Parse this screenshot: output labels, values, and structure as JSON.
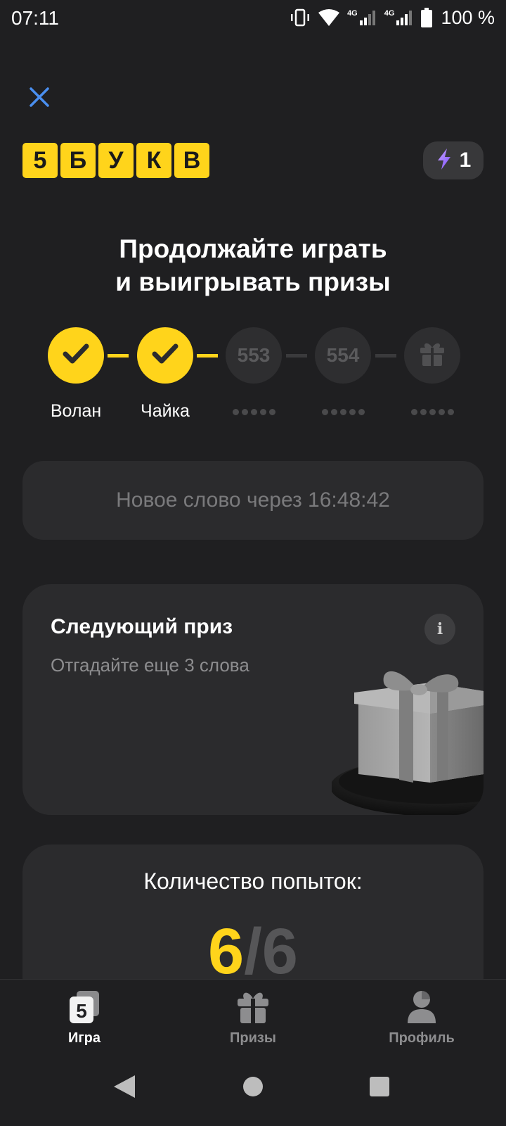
{
  "status_bar": {
    "time": "07:11",
    "network_1": "4G",
    "network_2": "4G",
    "battery": "100 %"
  },
  "header": {
    "logo_letters": [
      "5",
      "Б",
      "У",
      "К",
      "В"
    ],
    "energy_count": "1"
  },
  "headline": {
    "line1": "Продолжайте играть",
    "line2": "и выигрывать призы"
  },
  "progress": {
    "steps": [
      {
        "state": "done",
        "label": "Волан"
      },
      {
        "state": "done",
        "label": "Чайка"
      },
      {
        "state": "todo",
        "number": "553"
      },
      {
        "state": "todo",
        "number": "554"
      },
      {
        "state": "gift",
        "icon": "gift-icon"
      }
    ]
  },
  "timer": {
    "text": "Новое слово через 16:48:42"
  },
  "prize": {
    "title": "Следующий приз",
    "subtitle": "Отгадайте еще 3 слова",
    "info_label": "i"
  },
  "attempts": {
    "title": "Количество попыток:",
    "left": "6",
    "separator": "/",
    "total": "6"
  },
  "bottom_nav": {
    "items": [
      {
        "label": "Игра",
        "icon": "game-icon",
        "active": true
      },
      {
        "label": "Призы",
        "icon": "gift-icon",
        "active": false
      },
      {
        "label": "Профиль",
        "icon": "profile-icon",
        "active": false
      }
    ]
  },
  "colors": {
    "accent": "#ffd41b",
    "background": "#1f1f21",
    "card": "#2b2b2d",
    "muted_text": "#8d8d8f"
  }
}
